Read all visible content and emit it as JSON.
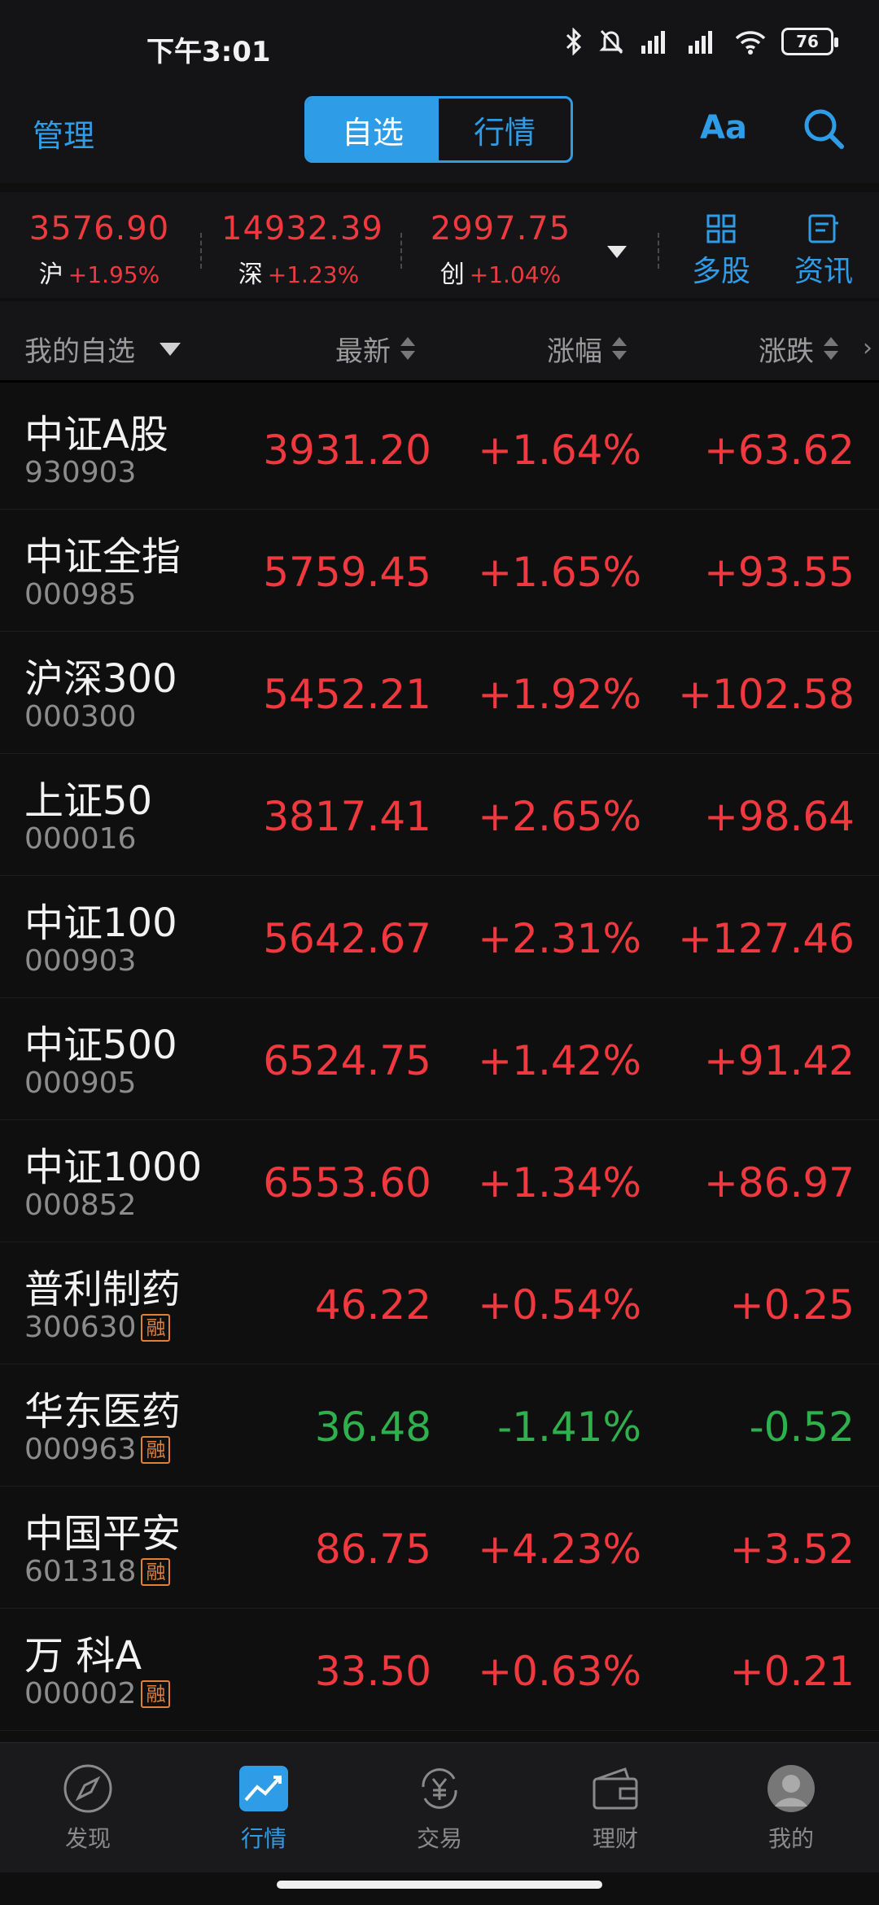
{
  "status": {
    "time": "下午3:01",
    "battery": "76"
  },
  "header": {
    "manage": "管理",
    "tabs": [
      "自选",
      "行情"
    ],
    "font_toggle": "Aa"
  },
  "indices": [
    {
      "value": "3576.90",
      "name": "沪",
      "change": "+1.95%"
    },
    {
      "value": "14932.39",
      "name": "深",
      "change": "+1.23%"
    },
    {
      "value": "2997.75",
      "name": "创",
      "change": "+1.04%"
    }
  ],
  "tools": {
    "multi": "多股",
    "news": "资讯"
  },
  "columns": {
    "group": "我的自选",
    "latest": "最新",
    "pct": "涨幅",
    "change": "涨跌"
  },
  "rows": [
    {
      "name": "中证A股",
      "code": "930903",
      "price": "3931.20",
      "pct": "+1.64%",
      "chg": "+63.62",
      "dir": "up",
      "margin": ""
    },
    {
      "name": "中证全指",
      "code": "000985",
      "price": "5759.45",
      "pct": "+1.65%",
      "chg": "+93.55",
      "dir": "up",
      "margin": ""
    },
    {
      "name": "沪深300",
      "code": "000300",
      "price": "5452.21",
      "pct": "+1.92%",
      "chg": "+102.58",
      "dir": "up",
      "margin": ""
    },
    {
      "name": "上证50",
      "code": "000016",
      "price": "3817.41",
      "pct": "+2.65%",
      "chg": "+98.64",
      "dir": "up",
      "margin": ""
    },
    {
      "name": "中证100",
      "code": "000903",
      "price": "5642.67",
      "pct": "+2.31%",
      "chg": "+127.46",
      "dir": "up",
      "margin": ""
    },
    {
      "name": "中证500",
      "code": "000905",
      "price": "6524.75",
      "pct": "+1.42%",
      "chg": "+91.42",
      "dir": "up",
      "margin": ""
    },
    {
      "name": "中证1000",
      "code": "000852",
      "price": "6553.60",
      "pct": "+1.34%",
      "chg": "+86.97",
      "dir": "up",
      "margin": ""
    },
    {
      "name": "普利制药",
      "code": "300630",
      "price": "46.22",
      "pct": "+0.54%",
      "chg": "+0.25",
      "dir": "up",
      "margin": "融"
    },
    {
      "name": "华东医药",
      "code": "000963",
      "price": "36.48",
      "pct": "-1.41%",
      "chg": "-0.52",
      "dir": "down",
      "margin": "融"
    },
    {
      "name": "中国平安",
      "code": "601318",
      "price": "86.75",
      "pct": "+4.23%",
      "chg": "+3.52",
      "dir": "up",
      "margin": "融"
    },
    {
      "name": "万 科A",
      "code": "000002",
      "price": "33.50",
      "pct": "+0.63%",
      "chg": "+0.21",
      "dir": "up",
      "margin": "融"
    }
  ],
  "tabbar": [
    "发现",
    "行情",
    "交易",
    "理财",
    "我的"
  ],
  "colors": {
    "accent": "#2f9ce8",
    "up": "#f0393f",
    "down": "#2fb04c"
  }
}
